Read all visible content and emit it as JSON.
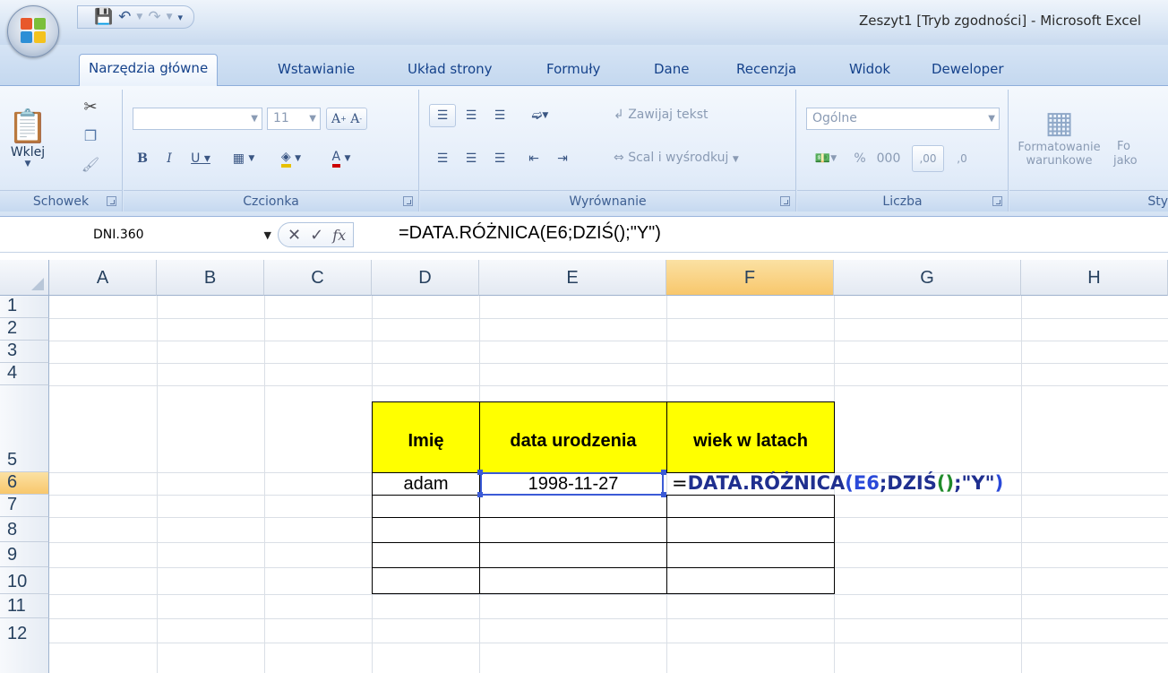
{
  "window": {
    "title": "Zeszyt1  [Tryb zgodności] - Microsoft Excel"
  },
  "tabs": [
    {
      "label": "Narzędzia główne",
      "active": true
    },
    {
      "label": "Wstawianie"
    },
    {
      "label": "Układ strony"
    },
    {
      "label": "Formuły"
    },
    {
      "label": "Dane"
    },
    {
      "label": "Recenzja"
    },
    {
      "label": "Widok"
    },
    {
      "label": "Deweloper"
    }
  ],
  "ribbon": {
    "clipboard": {
      "label": "Schowek",
      "paste": "Wklej"
    },
    "font": {
      "label": "Czcionka",
      "size": "11"
    },
    "alignment": {
      "label": "Wyrównanie",
      "wrap": "Zawijaj tekst",
      "merge": "Scal i wyśrodkuj"
    },
    "number": {
      "label": "Liczba",
      "format": "Ogólne",
      "percent": "%",
      "thousands": "000",
      "inc_dec": ",00",
      "dec_dec": ",0"
    },
    "styles": {
      "label": "Sty",
      "cond_line1": "Formatowanie",
      "cond_line2": "warunkowe",
      "fo": "Fo",
      "jako": "jako"
    }
  },
  "formula_bar": {
    "name_box": "DNI.360",
    "fx": "fx",
    "formula": "=DATA.RÓŻNICA(E6;DZIŚ();\"Y\")"
  },
  "grid": {
    "columns": [
      "A",
      "B",
      "C",
      "D",
      "E",
      "F",
      "G",
      "H"
    ],
    "rows": [
      "1",
      "2",
      "3",
      "4",
      "5",
      "6",
      "7",
      "8",
      "9",
      "10",
      "11",
      "12"
    ],
    "selected_column": "F",
    "selected_row": "6"
  },
  "table": {
    "headers": [
      "Imię",
      "data urodzenia",
      "wiek w latach"
    ],
    "row6": {
      "name": "adam",
      "birthdate": "1998-11-27"
    },
    "editing": {
      "eq": "=",
      "fn": "DATA.RÓŻNICA",
      "p1": "(",
      "ref": "E6",
      "mid": ";DZIŚ",
      "p2": "()",
      "tail": ";\"Y\"",
      "p3": ")"
    }
  },
  "colors": {
    "header_fill": "#ffff00",
    "selection": "#3b5bd6",
    "ribbon_text": "#15428b"
  }
}
